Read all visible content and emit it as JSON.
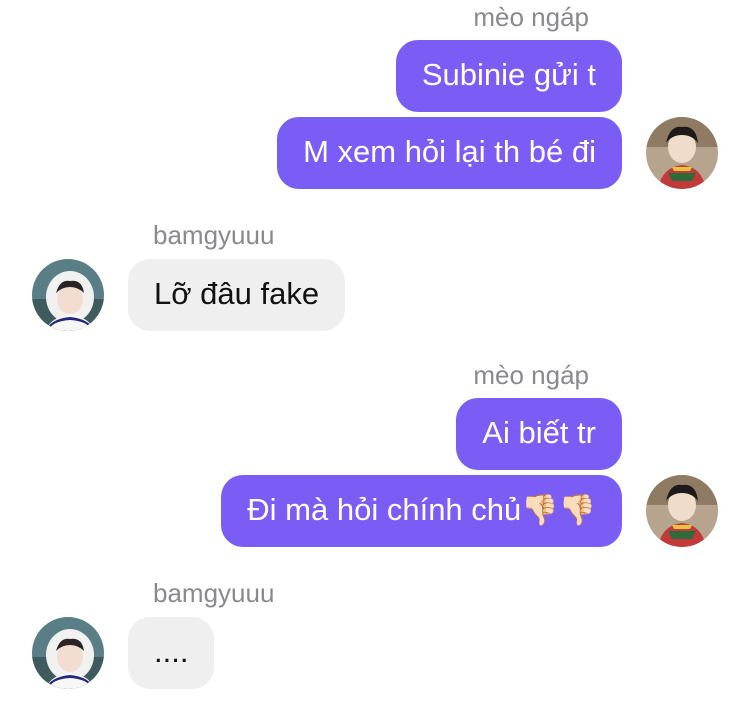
{
  "conversation": {
    "groups": [
      {
        "sender": "mèo ngáp",
        "messages": [
          "Subinie gửi t",
          "M xem hỏi lại th bé đi"
        ]
      },
      {
        "sender": "bamgyuuu",
        "messages": [
          "Lỡ đâu fake"
        ]
      },
      {
        "sender": "mèo ngáp",
        "messages": [
          "Ai biết tr",
          "Đi mà hỏi chính chủ",
          "👎🏻👎🏻"
        ]
      },
      {
        "sender": "bamgyuuu",
        "messages": [
          "...."
        ]
      }
    ]
  },
  "avatars": {
    "self": "avatar-meo-ngap",
    "other": "avatar-bamgyuuu"
  },
  "colors": {
    "outgoing_bubble": "#7B5CF5",
    "incoming_bubble": "#EFEFEF",
    "sender_name": "#8a8a8e"
  }
}
